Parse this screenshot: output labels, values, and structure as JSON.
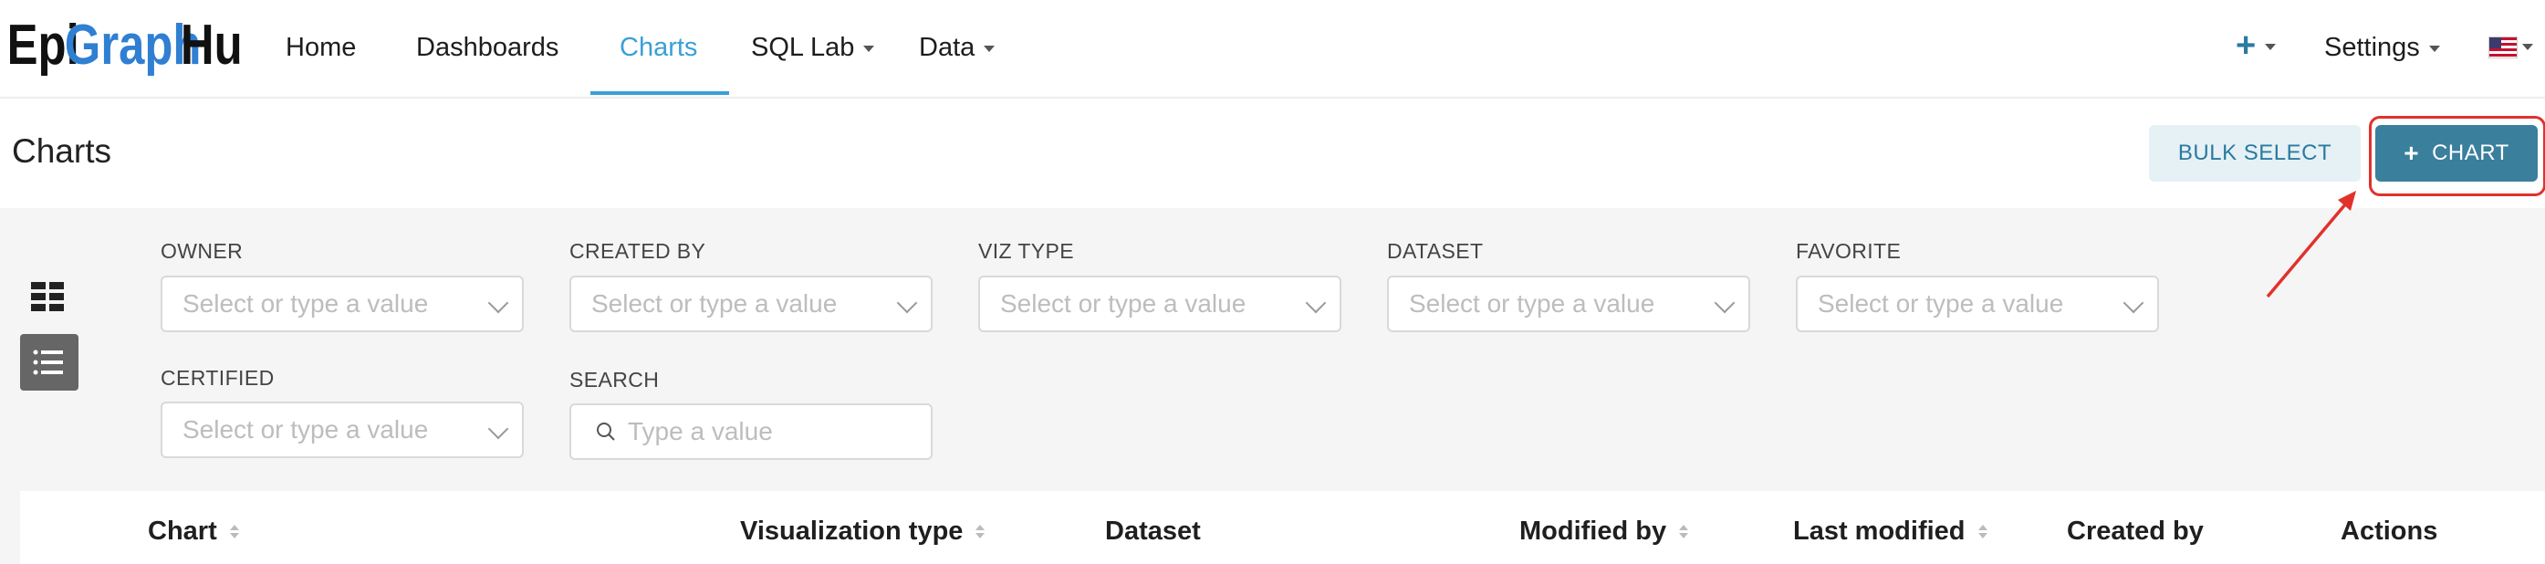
{
  "app": {
    "logo": {
      "part1": "Epi",
      "part2": "Graph",
      "part3": "Hub"
    },
    "colors": {
      "accent": "#3aa0d6",
      "primary_button": "#3a7f9c",
      "secondary_button_bg": "#e6f1f5",
      "annotation": "#e0322b",
      "panel_bg": "#f5f5f5"
    }
  },
  "nav": {
    "items": [
      {
        "label": "Home"
      },
      {
        "label": "Dashboards"
      },
      {
        "label": "Charts",
        "active": true
      },
      {
        "label": "SQL Lab",
        "dropdown": true
      },
      {
        "label": "Data",
        "dropdown": true
      }
    ],
    "right": {
      "new_icon": "plus-icon",
      "settings_label": "Settings",
      "language_icon": "us-flag-icon"
    }
  },
  "header": {
    "title": "Charts",
    "bulk_select_label": "BULK SELECT",
    "add_chart_label": "CHART"
  },
  "view_toggle": {
    "card_icon": "grid-view-icon",
    "list_icon": "list-view-icon"
  },
  "filters": {
    "owner": {
      "label": "OWNER",
      "placeholder": "Select or type a value"
    },
    "created_by": {
      "label": "CREATED BY",
      "placeholder": "Select or type a value"
    },
    "viz_type": {
      "label": "VIZ TYPE",
      "placeholder": "Select or type a value"
    },
    "dataset": {
      "label": "DATASET",
      "placeholder": "Select or type a value"
    },
    "favorite": {
      "label": "FAVORITE",
      "placeholder": "Select or type a value"
    },
    "certified": {
      "label": "CERTIFIED",
      "placeholder": "Select or type a value"
    },
    "search": {
      "label": "SEARCH",
      "placeholder": "Type a value"
    }
  },
  "table": {
    "columns": [
      {
        "label": "Chart",
        "sortable": true
      },
      {
        "label": "Visualization type",
        "sortable": true
      },
      {
        "label": "Dataset",
        "sortable": false
      },
      {
        "label": "Modified by",
        "sortable": true
      },
      {
        "label": "Last modified",
        "sortable": true
      },
      {
        "label": "Created by",
        "sortable": false
      },
      {
        "label": "Actions",
        "sortable": false
      }
    ]
  }
}
